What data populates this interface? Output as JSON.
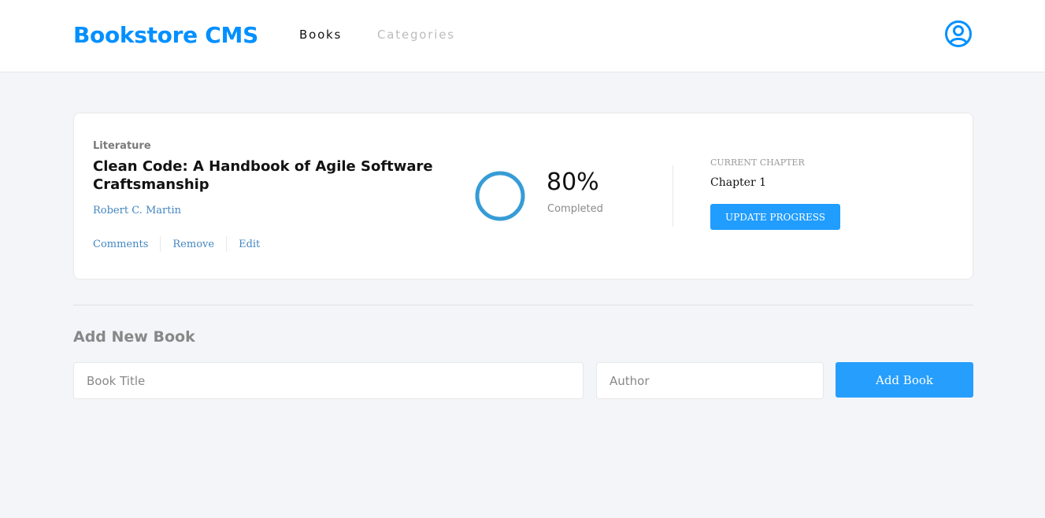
{
  "header": {
    "logo": "Bookstore CMS",
    "nav": [
      {
        "label": "Books"
      },
      {
        "label": "Categories"
      }
    ],
    "user_icon": "user-circle-icon"
  },
  "books": [
    {
      "genre": "Literature",
      "title": "Clean Code: A Handbook of Agile Software Craftsmanship",
      "author": "Robert C. Martin",
      "actions": [
        "Comments",
        "Remove",
        "Edit"
      ],
      "progress_percent": 80,
      "progress_text": "80%",
      "completed_label": "Completed",
      "current_chapter_label": "CURRENT CHAPTER",
      "current_chapter": "Chapter 1",
      "update_button": "UPDATE PROGRESS"
    }
  ],
  "form": {
    "heading": "Add New Book",
    "title_placeholder": "Book Title",
    "author_placeholder": "Author",
    "submit_label": "Add Book"
  },
  "colors": {
    "accent": "#0290ff",
    "ring": "#379cd6",
    "link": "#4386bf",
    "background": "#f4f5f9"
  }
}
